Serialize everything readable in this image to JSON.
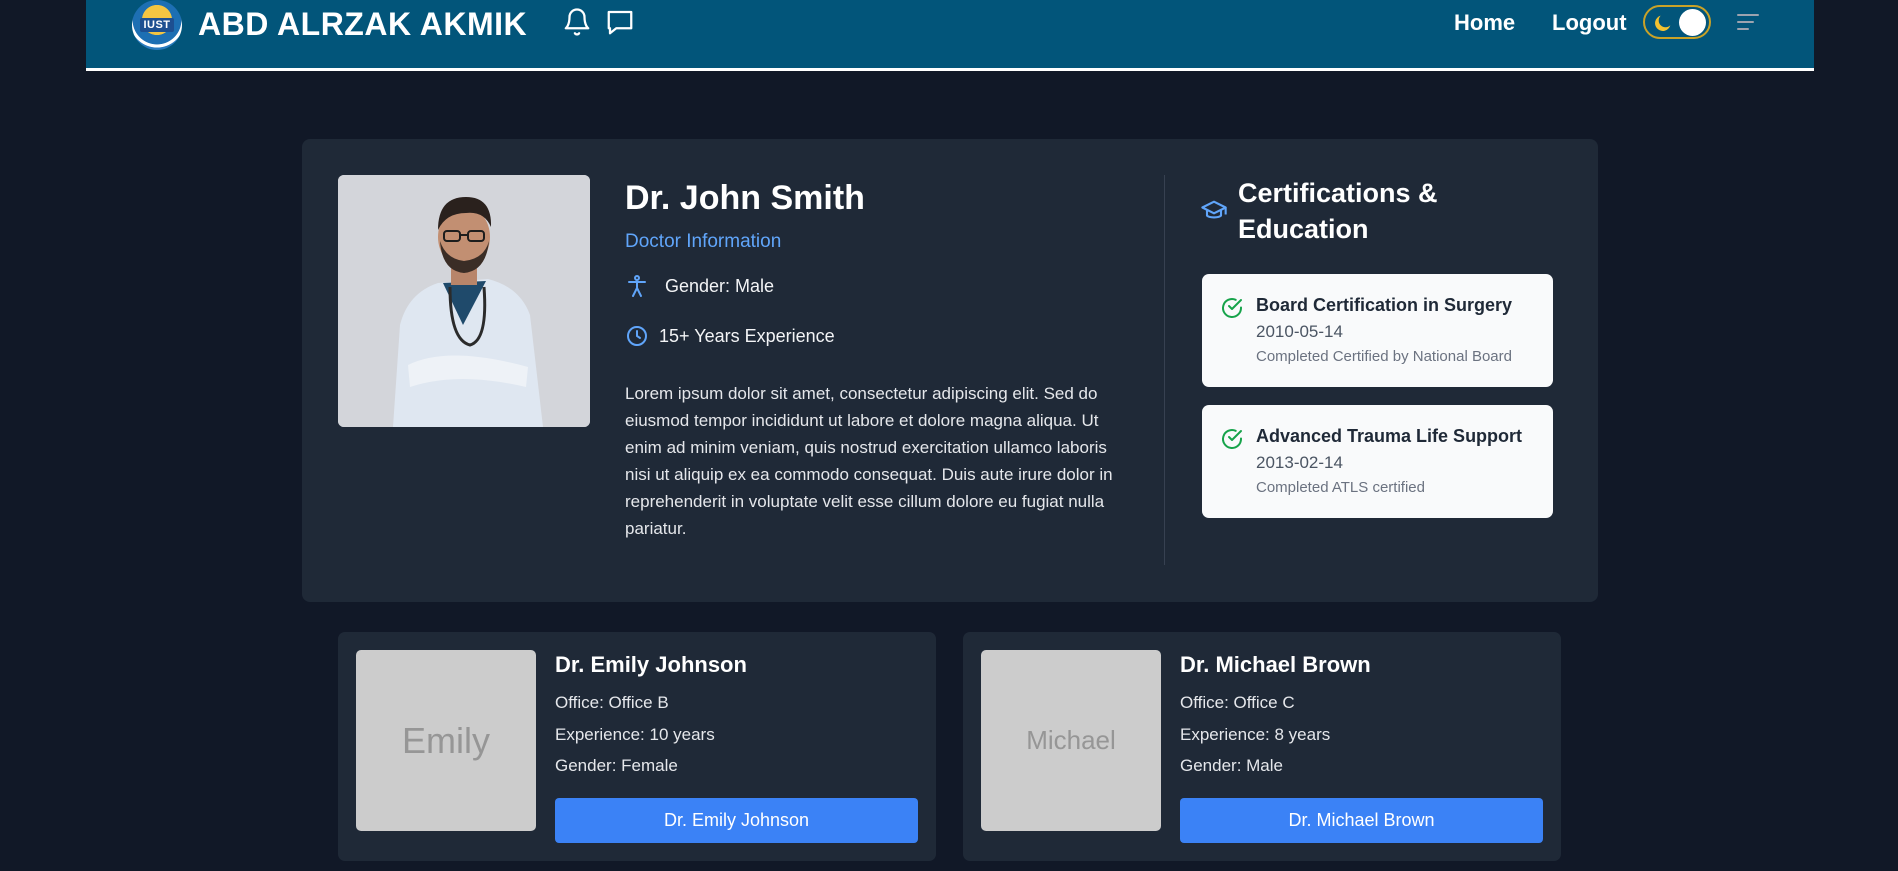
{
  "navbar": {
    "logo_text": "IUST",
    "brand": "ABD ALRZAK AKMIK",
    "links": {
      "home": "Home",
      "logout": "Logout"
    },
    "icons": [
      "bell-icon",
      "chat-icon",
      "moon-icon",
      "menu-icon"
    ],
    "theme": "dark"
  },
  "doctor": {
    "name": "Dr. John Smith",
    "subtitle": "Doctor Information",
    "gender": "Gender: Male",
    "experience": "15+ Years Experience",
    "bio": "Lorem ipsum dolor sit amet, consectetur adipiscing elit. Sed do eiusmod tempor incididunt ut labore et dolore magna aliqua. Ut enim ad minim veniam, quis nostrud exercitation ullamco laboris nisi ut aliquip ex ea commodo consequat. Duis aute irure dolor in reprehenderit in voluptate velit esse cillum dolore eu fugiat nulla pariatur."
  },
  "certifications": {
    "heading": "Certifications & Education",
    "items": [
      {
        "title": "Board Certification in Surgery",
        "date": "2010-05-14",
        "note": "Completed Certified by National Board"
      },
      {
        "title": "Advanced Trauma Life Support",
        "date": "2013-02-14",
        "note": "Completed ATLS certified"
      }
    ]
  },
  "other_doctors": [
    {
      "photo_text": "Emily",
      "name": "Dr. Emily Johnson",
      "office": "Office: Office B",
      "experience": "Experience: 10 years",
      "gender": "Gender: Female",
      "button": "Dr. Emily Johnson"
    },
    {
      "photo_text": "Michael",
      "name": "Dr. Michael Brown",
      "office": "Office: Office C",
      "experience": "Experience: 8 years",
      "gender": "Gender: Male",
      "button": "Dr. Michael Brown"
    }
  ],
  "colors": {
    "page_bg": "#111827",
    "navbar_bg": "#02557a",
    "card_bg": "#1f2937",
    "accent_blue": "#3b82f6",
    "link_blue": "#60a5fa",
    "success_green": "#16a34a",
    "toggle_border": "#c9a227"
  }
}
